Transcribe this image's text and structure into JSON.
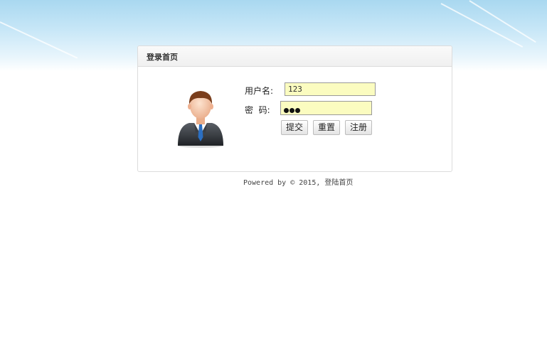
{
  "panel": {
    "title": "登录首页"
  },
  "form": {
    "username_label": "用户名:",
    "username_value": "123",
    "password_label": "密  码:",
    "password_mask_count": 3
  },
  "buttons": {
    "submit": "提交",
    "reset": "重置",
    "register": "注册"
  },
  "footer": {
    "text": "Powered by © 2015, 登陆首页"
  },
  "colors": {
    "input_background": "#fbfcc0",
    "sky_top": "#a9d8f0"
  },
  "icons": {
    "avatar": "user-avatar-icon"
  }
}
